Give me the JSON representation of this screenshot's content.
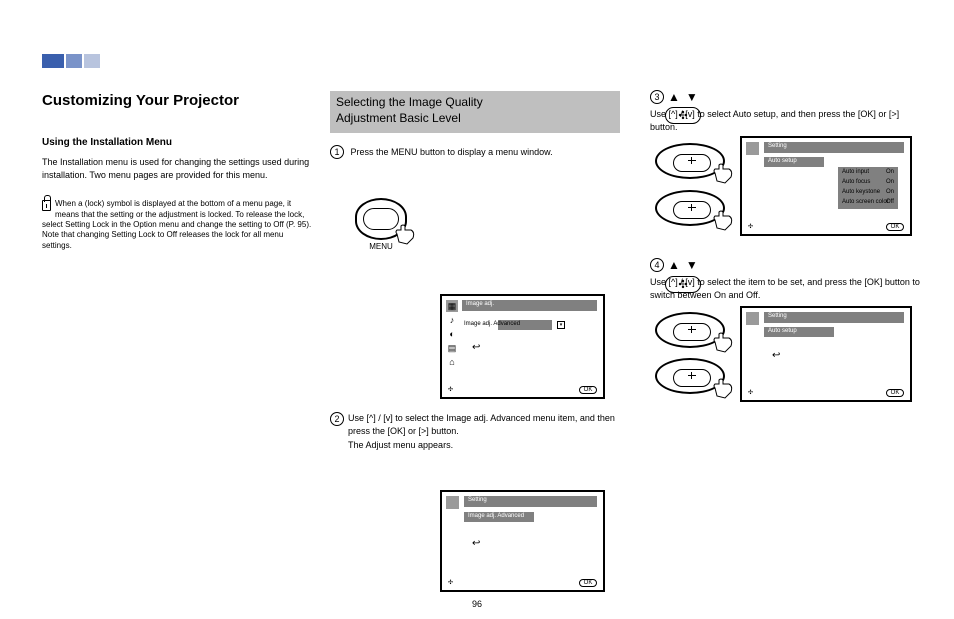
{
  "header": {
    "title": "Customizing Your Projector",
    "subtitle": "Using the Installation Menu",
    "intro": "The Installation menu is used for changing the settings used during installation. Two menu pages are provided for this menu."
  },
  "notice": {
    "lines": [
      "When a (lock) symbol is displayed at the bottom of a menu page, it means that the setting or the adjustment is locked. To release the lock, select Setting Lock in the Option menu and change the setting to Off (P. 95). Note that changing Setting Lock to Off releases the lock for all menu settings."
    ]
  },
  "step1": {
    "banner_a": "Selecting the Image Quality",
    "banner_b": "Adjustment Basic Level",
    "press_menu": "Press the MENU button to display a menu window.",
    "menu_btn": "MENU",
    "osd_top": "Image adj."
  },
  "step2": {
    "line1": "Use [^] / [v] to select the Image adj. Advanced menu item, and then press the [OK] or [>] button.",
    "line2": "The Adjust menu appears.",
    "osd_top": "Setting",
    "osd_item": "Image adj.  Advanced"
  },
  "step3_header": "Use [^] / [v] to select Auto setup, and then press the [OK] or [>] button.",
  "osd3": {
    "top": "Setting",
    "row1": "Auto setup",
    "row2": "Auto input",
    "row2_val": "On",
    "row3": "Auto focus",
    "row3_val": "On",
    "row4": "Auto keystone",
    "row4_val": "On",
    "row5": "Auto screen color",
    "row5_val": "Off"
  },
  "step4_header": "Use [^] / [v] to select the item to be set, and press the [OK] button to switch between On and Off.",
  "osd4": {
    "top": "Setting",
    "row1": "Auto setup"
  },
  "pagenum": "96"
}
